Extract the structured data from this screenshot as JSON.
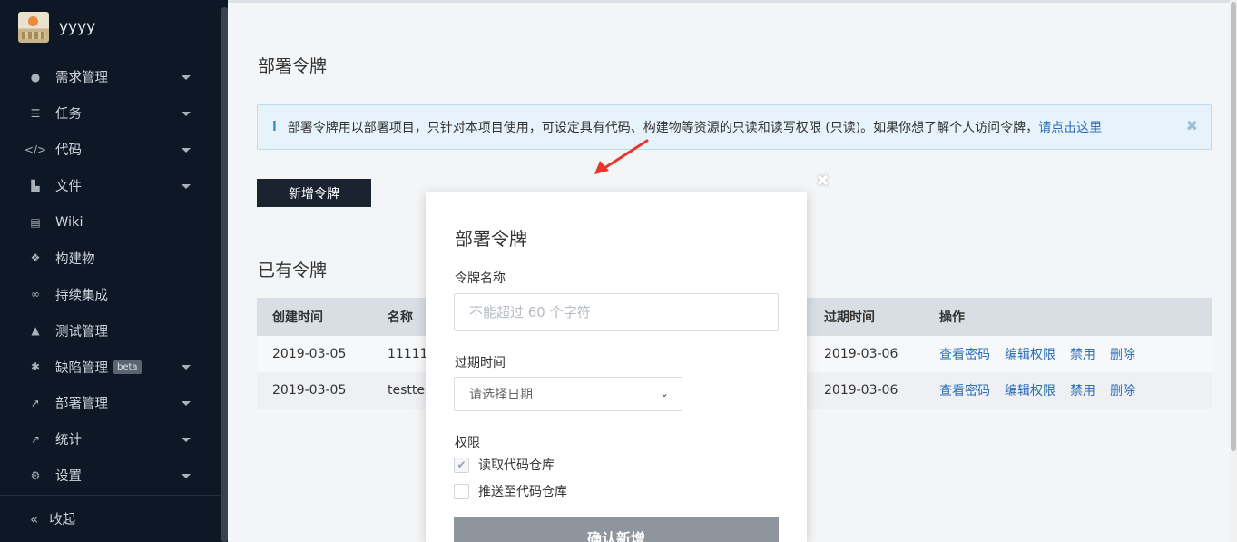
{
  "sidebar": {
    "username": "yyyy",
    "items": [
      {
        "label": "需求管理",
        "icon": "lightbulb-icon",
        "glyph": "●",
        "caret": true
      },
      {
        "label": "任务",
        "icon": "task-list-icon",
        "glyph": "☰",
        "caret": true
      },
      {
        "label": "代码",
        "icon": "code-icon",
        "glyph": "</>",
        "caret": true
      },
      {
        "label": "文件",
        "icon": "file-icon",
        "glyph": "▙",
        "caret": true
      },
      {
        "label": "Wiki",
        "icon": "wiki-icon",
        "glyph": "▤",
        "caret": false
      },
      {
        "label": "构建物",
        "icon": "artifacts-icon",
        "glyph": "❖",
        "caret": false
      },
      {
        "label": "持续集成",
        "icon": "infinity-icon",
        "glyph": "∞",
        "caret": false
      },
      {
        "label": "测试管理",
        "icon": "flask-icon",
        "glyph": "▲",
        "caret": false
      },
      {
        "label": "缺陷管理",
        "icon": "bug-icon",
        "glyph": "✱",
        "caret": true,
        "badge": "beta"
      },
      {
        "label": "部署管理",
        "icon": "rocket-icon",
        "glyph": "➚",
        "caret": true
      },
      {
        "label": "统计",
        "icon": "chart-icon",
        "glyph": "↗",
        "caret": true
      },
      {
        "label": "设置",
        "icon": "gear-icon",
        "glyph": "⚙",
        "caret": true
      }
    ],
    "collapse_label": "收起",
    "collapse_glyph": "«"
  },
  "main": {
    "page_title": "部署令牌",
    "alert": {
      "icon_glyph": "i",
      "text": "部署令牌用以部署项目，只针对本项目使用，可设定具有代码、构建物等资源的只读和读写权限 (只读)。如果你想了解个人访问令牌，",
      "link": "请点击这里",
      "close_glyph": "✖"
    },
    "add_button": "新增令牌",
    "section_title": "已有令牌",
    "table": {
      "headers": [
        "创建时间",
        "名称",
        "过期时间",
        "操作"
      ],
      "rows": [
        {
          "created": "2019-03-05",
          "name": "11111",
          "expires": "2019-03-06"
        },
        {
          "created": "2019-03-05",
          "name": "testtes",
          "expires": "2019-03-06"
        }
      ],
      "actions": [
        "查看密码",
        "编辑权限",
        "禁用",
        "删除"
      ]
    }
  },
  "modal": {
    "close_glyph": "✖",
    "title": "部署令牌",
    "name_label": "令牌名称",
    "name_placeholder": "不能超过 60 个字符",
    "expire_label": "过期时间",
    "expire_placeholder": "请选择日期",
    "expire_chevron": "⌄",
    "perm_label": "权限",
    "permissions": [
      {
        "label": "读取代码仓库",
        "checked": true
      },
      {
        "label": "推送至代码仓库",
        "checked": false
      }
    ],
    "check_glyph": "✔",
    "confirm": "确认新增"
  },
  "colors": {
    "sidebar_bg": "#0e1725",
    "primary_dark": "#1b2330",
    "link": "#2b6db8",
    "arrow_red": "#e8352b"
  }
}
